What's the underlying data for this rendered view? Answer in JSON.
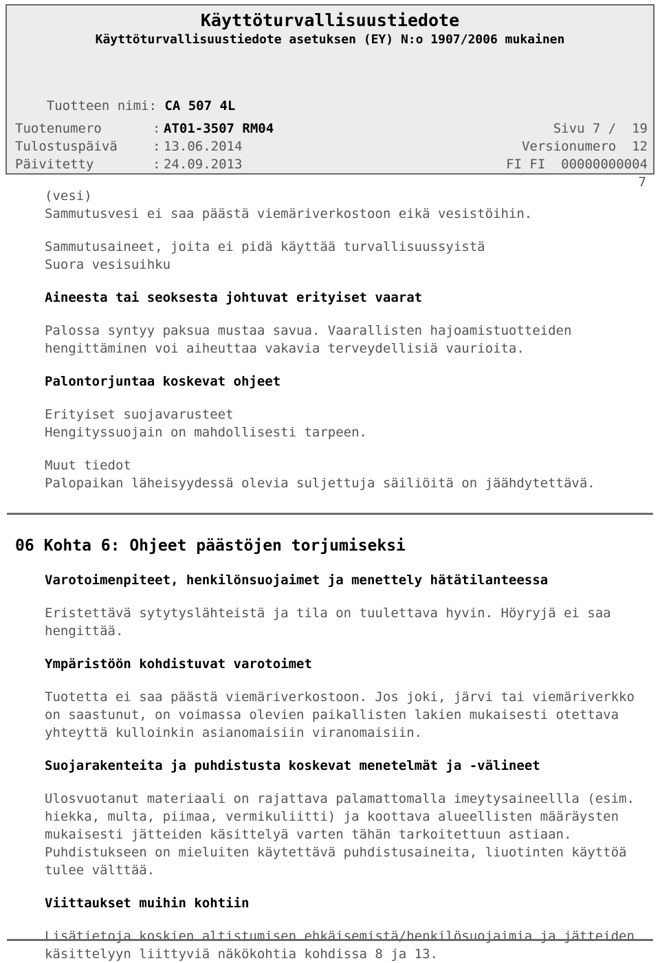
{
  "header": {
    "title": "Käyttöturvallisuustiedote",
    "subtitle": "Käyttöturvallisuustiedote asetuksen (EY) N:o 1907/2006 mukainen",
    "product_label": "Tuotteen nimi:",
    "product_name": "CA 507 4L",
    "rows": [
      {
        "label": "Tuotenumero",
        "colon": ":",
        "value": "AT01-3507 RM04",
        "bold": true,
        "right": "Sivu 7 /  19"
      },
      {
        "label": "Tulostuspäivä",
        "colon": ":",
        "value": "13.06.2014",
        "bold": false,
        "right": "Versionumero  12"
      },
      {
        "label": "Päivitetty",
        "colon": ":",
        "value": "24.09.2013",
        "bold": false,
        "right": "FI FI  00000000004"
      }
    ],
    "tail": "7"
  },
  "body": {
    "p1": "(vesi)",
    "p2": "Sammutusvesi ei saa päästä viemäriverkostoon eikä vesistöihin.",
    "p3": "Sammutusaineet, joita ei pidä käyttää turvallisuussyistä",
    "p4": "Suora vesisuihku",
    "h1": "Aineesta tai seoksesta johtuvat erityiset vaarat",
    "p5": "Palossa syntyy paksua mustaa savua. Vaarallisten hajoamistuotteiden hengittäminen voi aiheuttaa vakavia terveydellisiä vaurioita.",
    "h2": "Palontorjuntaa koskevat ohjeet",
    "p6": "Erityiset suojavarusteet",
    "p7": "Hengityssuojain on mahdollisesti tarpeen.",
    "p8": "Muut tiedot",
    "p9": "Palopaikan läheisyydessä olevia suljettuja säiliöitä on jäähdytettävä.",
    "section_number": "06",
    "section_title": "Kohta 6: Ohjeet päästöjen torjumiseksi",
    "h3": "Varotoimenpiteet, henkilönsuojaimet ja menettely hätätilanteessa",
    "p10": "Eristettävä sytytyslähteistä ja tila on tuulettava hyvin. Höyryjä ei saa hengittää.",
    "h4": "Ympäristöön kohdistuvat varotoimet",
    "p11": "Tuotetta ei saa päästä viemäriverkostoon. Jos joki, järvi tai viemäriverkko on saastunut, on voimassa olevien paikallisten lakien mukaisesti otettava yhteyttä kulloinkin asianomaisiin viranomaisiin.",
    "h5": "Suojarakenteita ja puhdistusta koskevat menetelmät ja -välineet",
    "p12": "Ulosvuotanut materiaali on rajattava palamattomalla imeytysaineellla (esim. hiekka, multa, piimaa, vermikuliitti) ja koottava alueellisten määräysten mukaisesti jätteiden käsittelyä varten tähän tarkoitettuun astiaan. Puhdistukseen on mieluiten käytettävä puhdistusaineita, liuotinten käyttöä tulee välttää.",
    "h6": "Viittaukset muihin kohtiin",
    "p13": "Lisätietoja koskien altistumisen ehkäisemistä/henkilösuojaimia ja jätteiden käsittelyyn liittyviä näkökohtia kohdissa 8 ja 13."
  }
}
